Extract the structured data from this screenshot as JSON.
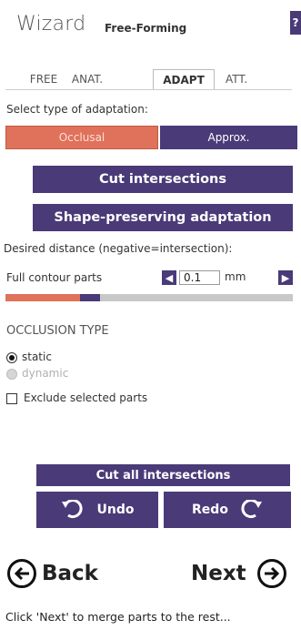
{
  "header": {
    "title": "Wizard",
    "subtitle": "Free-Forming",
    "help_label": "?"
  },
  "tabs": [
    {
      "label": "FREE",
      "active": false
    },
    {
      "label": "ANAT.",
      "active": false
    },
    {
      "label": "ADAPT",
      "active": true
    },
    {
      "label": "ATT.",
      "active": false
    }
  ],
  "adaptation": {
    "prompt": "Select type of adaptation:",
    "options": [
      {
        "label": "Occlusal",
        "selected": true
      },
      {
        "label": "Approx.",
        "selected": false
      }
    ],
    "cut_intersections_label": "Cut intersections",
    "shape_preserving_label": "Shape-preserving adaptation",
    "distance_label": "Desired distance (negative=intersection):",
    "contour_label": "Full contour parts",
    "distance_value": "0.1",
    "distance_unit": "mm",
    "slider_level": 0.33
  },
  "occlusion": {
    "title": "OCCLUSION TYPE",
    "options": [
      {
        "label": "static",
        "selected": true,
        "enabled": true
      },
      {
        "label": "dynamic",
        "selected": false,
        "enabled": false
      }
    ],
    "exclude_label": "Exclude selected parts",
    "exclude_checked": false
  },
  "actions": {
    "cut_all_label": "Cut all intersections",
    "undo_label": "Undo",
    "redo_label": "Redo"
  },
  "nav": {
    "back_label": "Back",
    "next_label": "Next",
    "footer_text": "Click 'Next' to merge parts to the rest..."
  },
  "colors": {
    "primary": "#4a3a78",
    "accent": "#e0715a",
    "track": "#c8c8c8"
  },
  "icons": [
    "help-icon",
    "chevron-left-icon",
    "chevron-right-icon",
    "undo-icon",
    "redo-icon",
    "arrow-left-circle-icon",
    "arrow-right-circle-icon"
  ]
}
